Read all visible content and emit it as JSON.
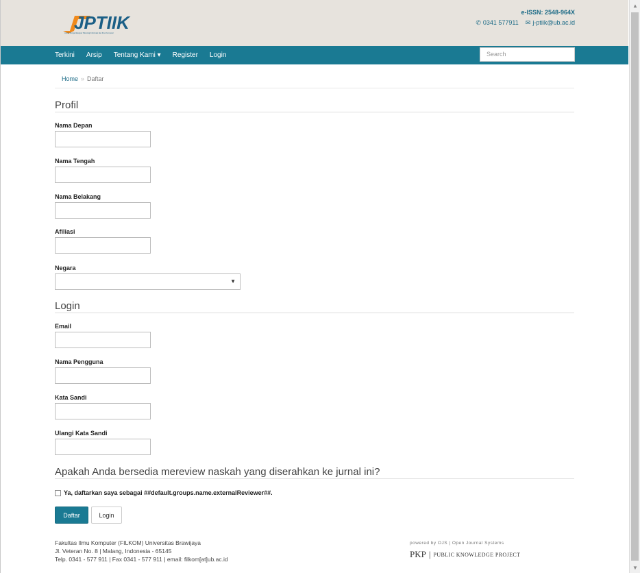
{
  "header": {
    "logo_text": "JPTIIK",
    "logo_subtitle": "Jurnal Pengembangan Teknologi Informasi dan Ilmu Komputer",
    "issn": "e-ISSN: 2548-964X",
    "phone": "0341 577911",
    "email": "j-ptiik@ub.ac.id"
  },
  "nav": {
    "items": [
      "Terkini",
      "Arsip",
      "Tentang Kami ▾",
      "Register",
      "Login"
    ],
    "search_placeholder": "Search"
  },
  "breadcrumb": {
    "home": "Home",
    "separator": "»",
    "current": "Daftar"
  },
  "profil": {
    "title": "Profil",
    "fields": [
      "Nama Depan",
      "Nama Tengah",
      "Nama Belakang",
      "Afiliasi"
    ],
    "country_label": "Negara",
    "country_value": ""
  },
  "login": {
    "title": "Login",
    "fields": [
      "Email",
      "Nama Pengguna",
      "Kata Sandi",
      "Ulangi Kata Sandi"
    ]
  },
  "review": {
    "title": "Apakah Anda bersedia mereview naskah yang diserahkan ke jurnal ini?",
    "checkbox_label": "Ya, daftarkan saya sebagai ##default.groups.name.externalReviewer##."
  },
  "buttons": {
    "submit": "Daftar",
    "login": "Login"
  },
  "footer": {
    "line1": "Fakultas Ilmu Komputer (FILKOM) Universitas Brawijaya",
    "line2": "Jl. Veteran No. 8 | Malang, Indonesia - 65145",
    "line3": "Telp. 0341 - 577 911 | Fax 0341 - 577 911 | email: filkom[at]ub.ac.id",
    "ojs": "powered by OJS | Open Journal Systems",
    "pkp": "PKP",
    "pkp_full": "PUBLIC KNOWLEDGE PROJECT"
  },
  "colors": {
    "navbar": "#1a7a93",
    "header_bg": "#e7e3dd",
    "logo_orange": "#f08a1c",
    "link": "#1b6a86"
  },
  "icons": [
    "phone-icon",
    "envelope-icon",
    "caret-down-icon",
    "scroll-up-icon",
    "scroll-down-icon"
  ]
}
